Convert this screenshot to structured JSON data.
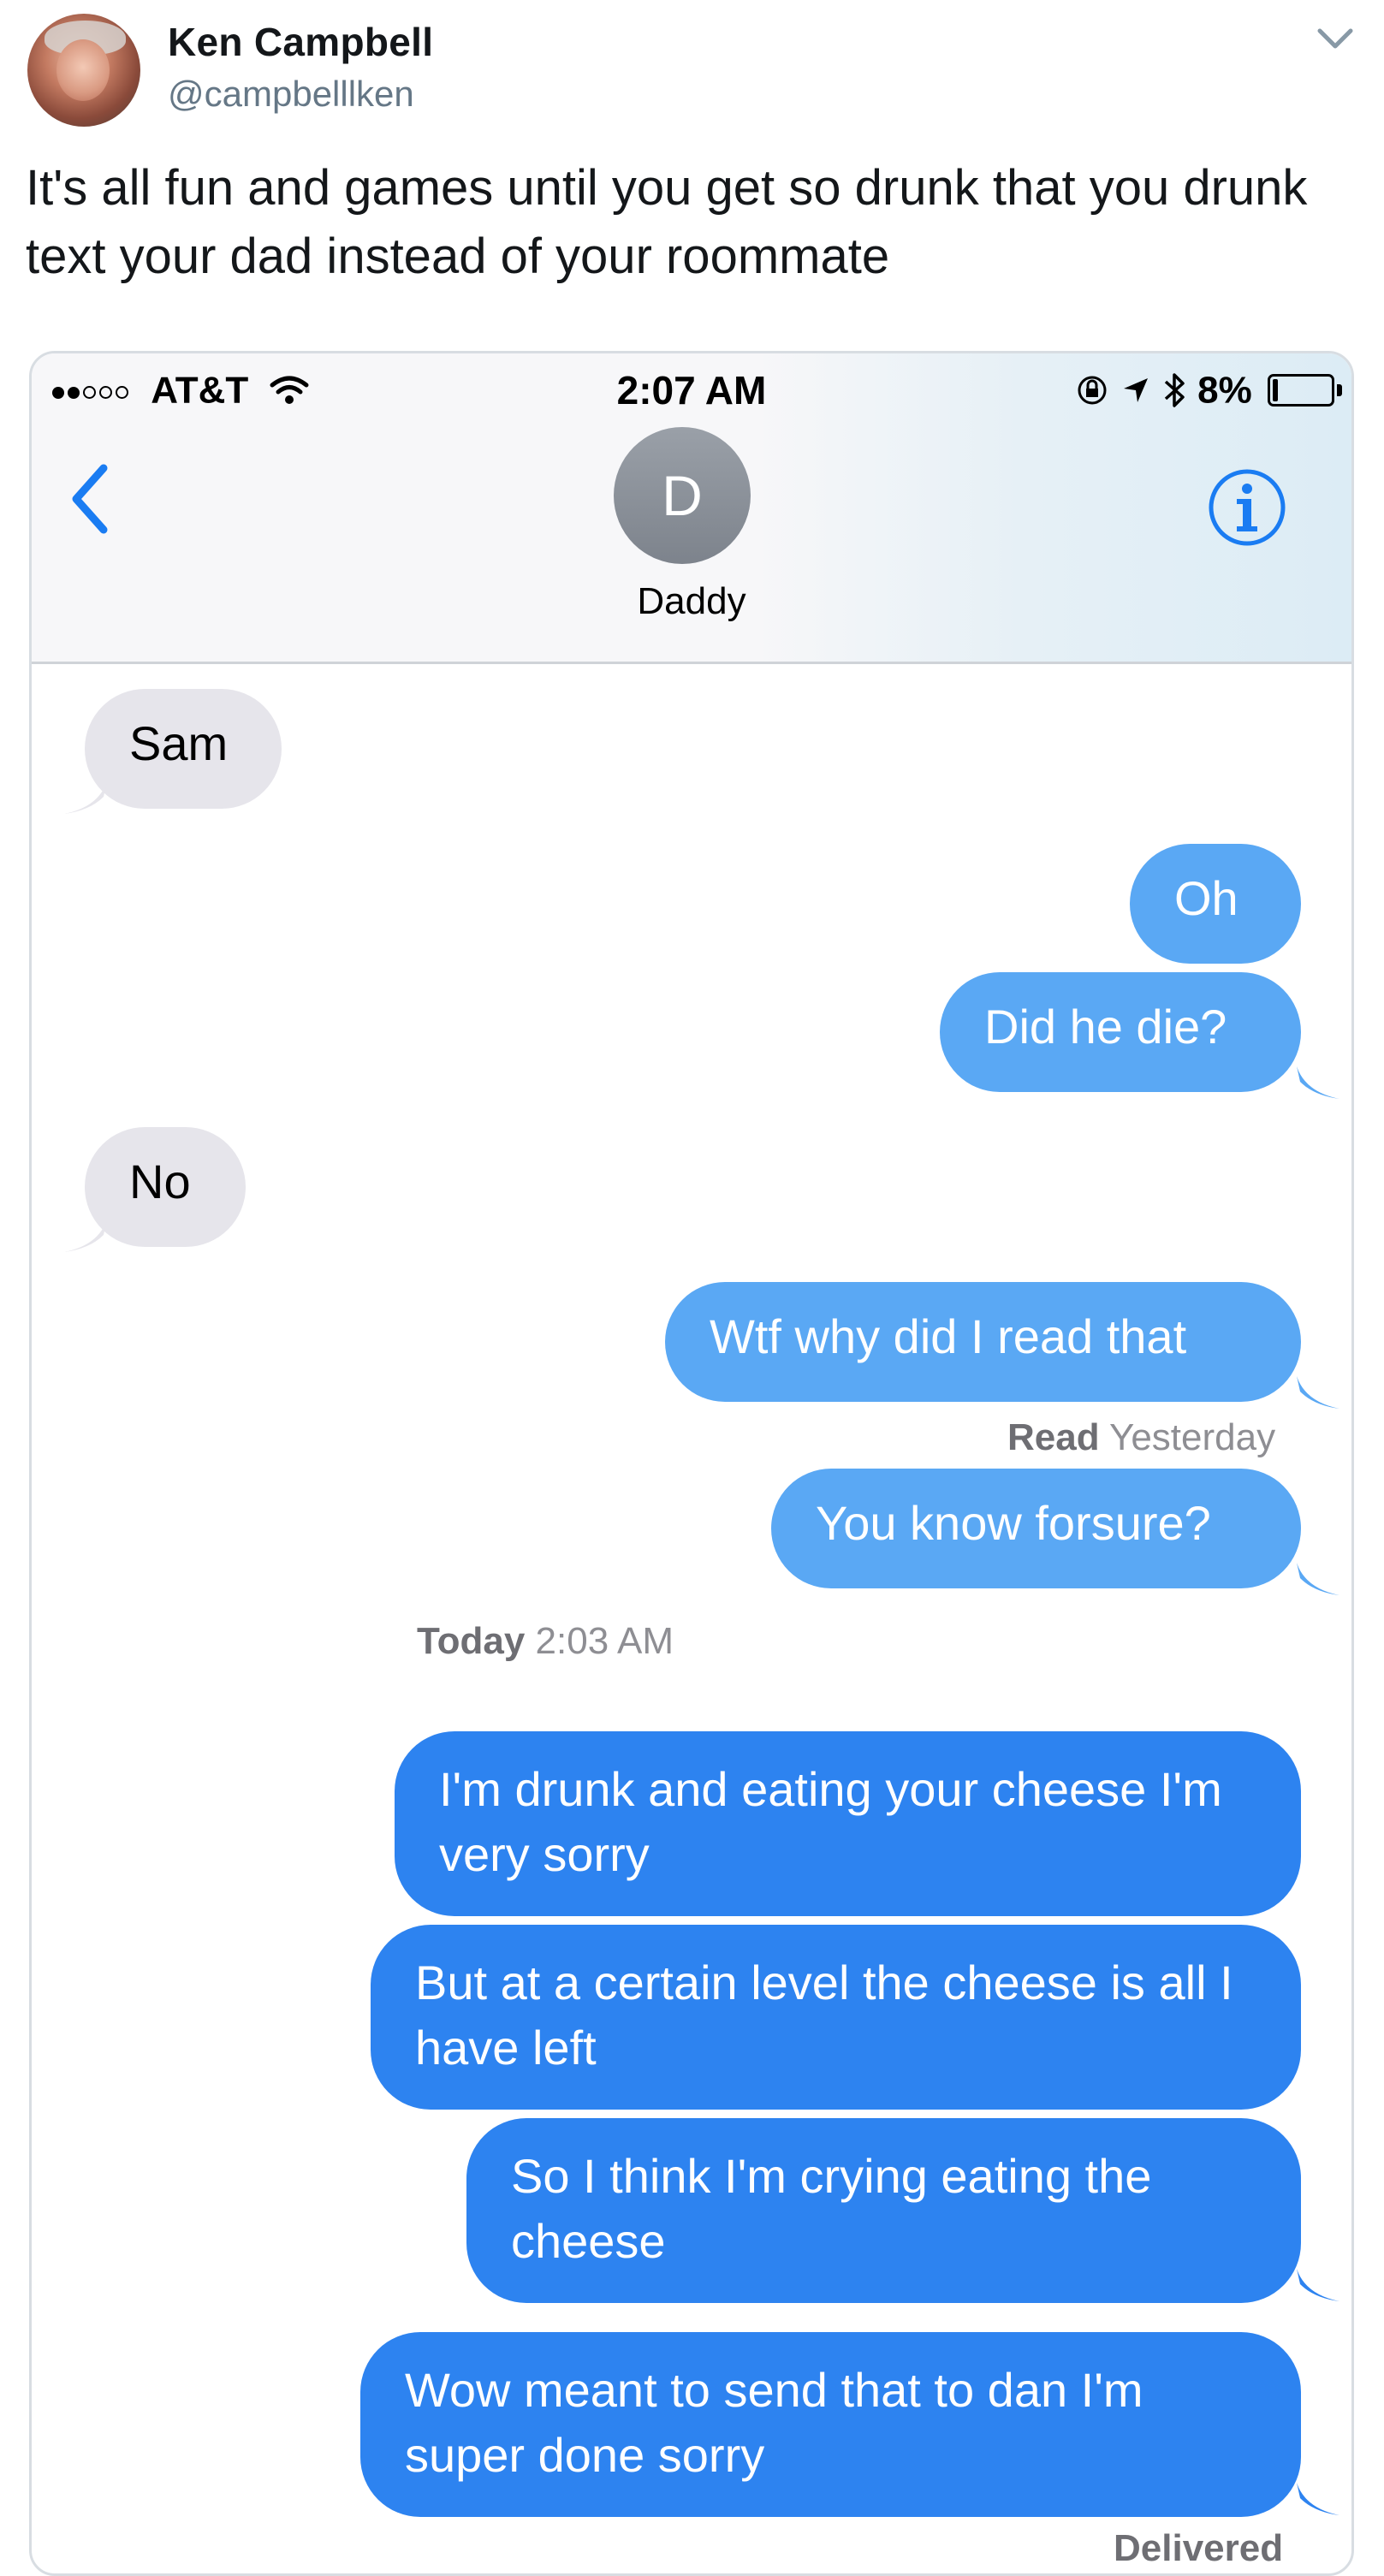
{
  "tweet": {
    "display_name": "Ken Campbell",
    "handle": "@campbelllken",
    "text": "It's all fun and games until you get so drunk that you drunk text your dad instead of your roommate"
  },
  "phone": {
    "status": {
      "carrier": "AT&T",
      "time": "2:07 AM",
      "battery": "8%"
    },
    "contact": {
      "initial": "D",
      "name": "Daddy"
    },
    "messages": [
      {
        "from": "them",
        "text": "Sam"
      },
      {
        "from": "me",
        "text": "Oh"
      },
      {
        "from": "me",
        "text": "Did he die?"
      },
      {
        "from": "them",
        "text": "No"
      },
      {
        "from": "me",
        "text": "Wtf why did I read that"
      },
      {
        "from": "me",
        "text": "You know forsure?"
      },
      {
        "from": "me",
        "text": "I'm drunk and eating your cheese I'm very sorry"
      },
      {
        "from": "me",
        "text": "But at a certain level the cheese is all I have left"
      },
      {
        "from": "me",
        "text": "So I think I'm crying eating the cheese"
      },
      {
        "from": "me",
        "text": "Wow meant to send that to dan I'm super done sorry"
      }
    ],
    "read_receipt": {
      "label": "Read",
      "when": "Yesterday"
    },
    "timestamp": {
      "day": "Today",
      "time": "2:03 AM"
    },
    "delivered": "Delivered"
  },
  "colors": {
    "imessage_blue_light": "#5aa8f4",
    "imessage_blue_dark": "#2d83f0",
    "incoming_gray": "#e6e5eb",
    "ios_link_blue": "#1a7cf2"
  }
}
